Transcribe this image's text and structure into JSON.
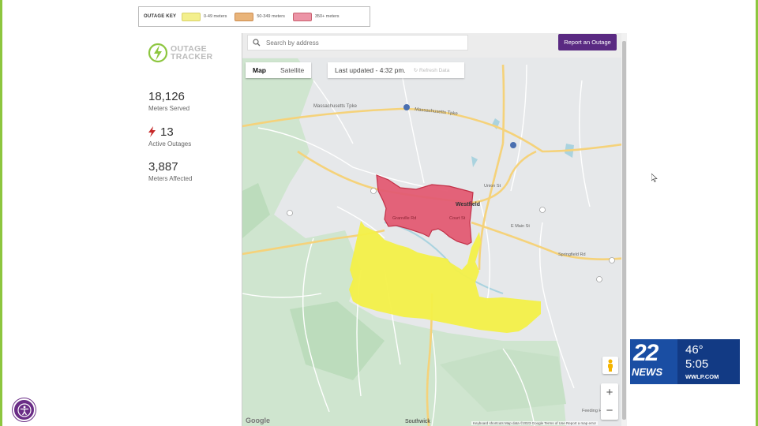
{
  "outage_key": {
    "title": "OUTAGE KEY",
    "items": [
      {
        "label": "0-49 meters",
        "color": "#f3ef8d",
        "border": "#d8d26a"
      },
      {
        "label": "50-349 meters",
        "color": "#e9b47a",
        "border": "#cc8c4f"
      },
      {
        "label": "350+ meters",
        "color": "#ec94a6",
        "border": "#c9606f"
      }
    ]
  },
  "logo": {
    "line1": "OUTAGE",
    "line2": "TRACKER",
    "icon": "outage-tracker-bolt-icon"
  },
  "stats": {
    "served_value": "18,126",
    "served_label": "Meters Served",
    "active_value": "13",
    "active_label": "Active Outages",
    "affected_value": "3,887",
    "affected_label": "Meters Affected"
  },
  "map": {
    "search_placeholder": "Search by address",
    "report_button": "Report an Outage",
    "map_tab": "Map",
    "satellite_tab": "Satellite",
    "last_updated": "Last updated - 4:32 pm.",
    "refresh_label": "Refresh Data",
    "zoom_in": "+",
    "zoom_out": "−",
    "google": "Google",
    "footer": "Keyboard shortcuts   Map data ©2023 Google   Terms of Use   Report a map error",
    "labels": {
      "westfield": "Westfield",
      "southwick": "Southwick",
      "mass_pike_1": "Massachusetts Tpke",
      "mass_pike_2": "Massachusetts Tpke",
      "main_st": "E Main St",
      "springfield_rd": "Springfield Rd",
      "union_st": "Union St",
      "court_st": "Court St",
      "granville_rd": "Granville Rd",
      "feeding_hills": "Feeding Hills"
    },
    "colors": {
      "yellow": "#f3f048",
      "red": "#e35b73",
      "red_border": "#c1273f",
      "water": "#aad3df",
      "green": "#cfe5cf",
      "road": "#f5d27a"
    }
  },
  "tv_bug": {
    "channel": "22",
    "news": "NEWS",
    "temp": "46°",
    "time": "5:05",
    "url": "WWLP.COM"
  },
  "accessibility_icon": "accessibility-icon"
}
